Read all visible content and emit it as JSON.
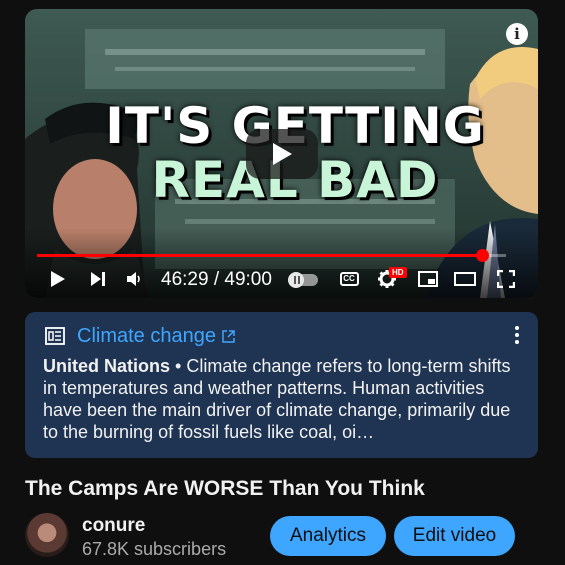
{
  "player": {
    "thumbnail_headline_line1": "IT'S GETTING",
    "thumbnail_headline_line2": "REAL BAD",
    "current_time": "46:29",
    "duration": "49:00",
    "progress_fraction": 0.949,
    "hd_badge": "HD",
    "cc_label": "CC",
    "icons": {
      "info": "info-icon",
      "play_center": "play-icon",
      "play": "play-icon",
      "next": "skip-next-icon",
      "volume": "volume-icon",
      "autoplay": "autoplay-toggle",
      "captions": "captions-icon",
      "settings": "gear-icon",
      "miniplayer": "miniplayer-icon",
      "theater": "theater-mode-icon",
      "fullscreen": "fullscreen-icon"
    }
  },
  "info_panel": {
    "title": "Climate change",
    "source": "United Nations",
    "separator": " • ",
    "description": "Climate change refers to long-term shifts in temperatures and weather patterns. Human activities have been the main driver of climate change, primarily due to the burning of fossil fuels like coal, oi…",
    "icons": {
      "article": "article-icon",
      "external": "external-link-icon",
      "menu": "more-vert-icon"
    },
    "colors": {
      "background": "#1f3452",
      "link": "#3ea6ff"
    }
  },
  "video": {
    "title": "The Camps Are WORSE Than You Think"
  },
  "channel": {
    "name": "conure",
    "subscribers": "67.8K subscribers",
    "analytics_label": "Analytics",
    "edit_label": "Edit video",
    "accent": "#3ea6ff"
  }
}
